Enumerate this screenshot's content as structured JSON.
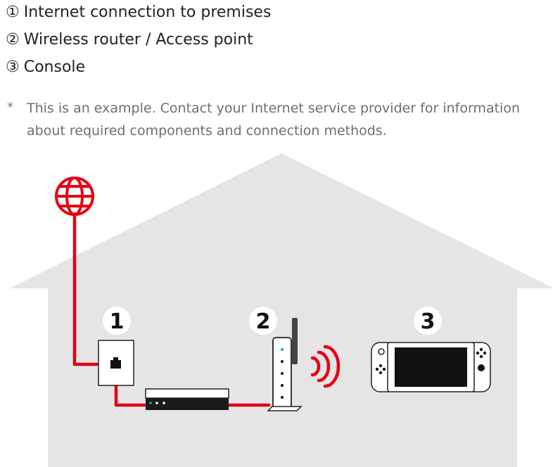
{
  "legend": [
    {
      "marker": "①",
      "label": "Internet connection to premises"
    },
    {
      "marker": "②",
      "label": "Wireless router / Access point"
    },
    {
      "marker": "③",
      "label": "Console"
    }
  ],
  "note": {
    "marker": "*",
    "text": "This is an example. Contact your Internet service provider for information about required components and connection methods."
  },
  "diagram": {
    "badges": {
      "internet": "1",
      "router": "2",
      "console": "3"
    },
    "icons": [
      "globe-icon",
      "wall-socket-icon",
      "modem-icon",
      "router-icon",
      "wifi-signal-icon",
      "console-icon"
    ],
    "colors": {
      "house": "#e5e5e5",
      "cable": "#e0001a",
      "globe": "#e60012",
      "device_outline": "#222222",
      "screen": "#111111"
    }
  }
}
